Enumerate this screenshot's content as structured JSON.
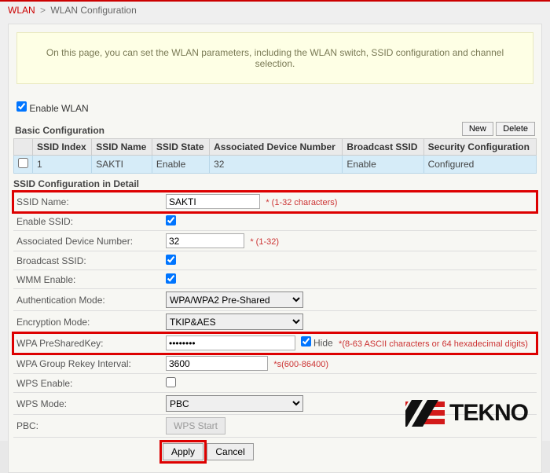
{
  "breadcrumb": {
    "root": "WLAN",
    "page": "WLAN Configuration"
  },
  "banner": "On this page, you can set the WLAN parameters, including the WLAN switch, SSID configuration and channel selection.",
  "enable_wlan": {
    "label": "Enable WLAN",
    "checked": true
  },
  "basic": {
    "title": "Basic Configuration",
    "new_label": "New",
    "delete_label": "Delete",
    "columns": [
      "SSID Index",
      "SSID Name",
      "SSID State",
      "Associated Device Number",
      "Broadcast SSID",
      "Security Configuration"
    ],
    "row": {
      "index": "1",
      "name": "SAKTI",
      "state": "Enable",
      "assoc": "32",
      "broadcast": "Enable",
      "security": "Configured"
    }
  },
  "detail": {
    "title": "SSID Configuration in Detail",
    "ssid_name": {
      "label": "SSID Name:",
      "value": "SAKTI",
      "hint": "* (1-32 characters)"
    },
    "enable_ssid": {
      "label": "Enable SSID:",
      "checked": true
    },
    "assoc_num": {
      "label": "Associated Device Number:",
      "value": "32",
      "hint": "* (1-32)"
    },
    "broadcast_ssid": {
      "label": "Broadcast SSID:",
      "checked": true
    },
    "wmm": {
      "label": "WMM Enable:",
      "checked": true
    },
    "auth_mode": {
      "label": "Authentication Mode:",
      "value": "WPA/WPA2 Pre-Shared"
    },
    "enc_mode": {
      "label": "Encryption Mode:",
      "value": "TKIP&AES"
    },
    "psk": {
      "label": "WPA PreSharedKey:",
      "value": "••••••••",
      "hide_label": "Hide",
      "hide_checked": true,
      "hint": "*(8-63 ASCII characters or 64 hexadecimal digits)"
    },
    "rekey": {
      "label": "WPA Group Rekey Interval:",
      "value": "3600",
      "hint": "*s(600-86400)"
    },
    "wps_enable": {
      "label": "WPS Enable:",
      "checked": false
    },
    "wps_mode": {
      "label": "WPS Mode:",
      "value": "PBC"
    },
    "pbc": {
      "label": "PBC:",
      "button": "WPS Start"
    }
  },
  "actions": {
    "apply": "Apply",
    "cancel": "Cancel"
  },
  "logo_text": "TEKNO"
}
